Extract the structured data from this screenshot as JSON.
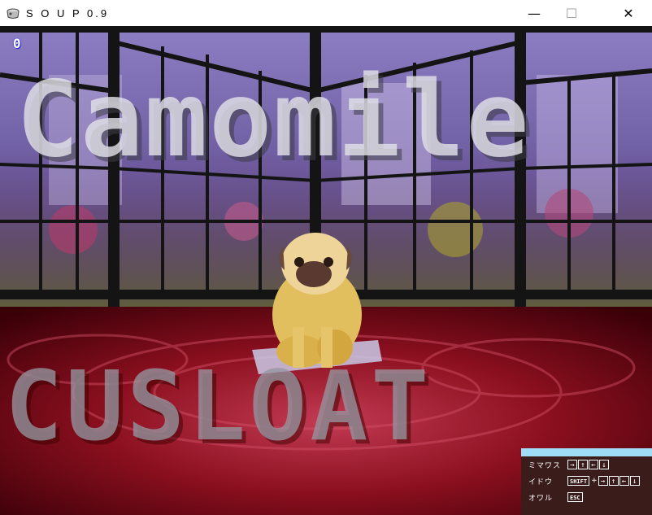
{
  "window": {
    "title": "S O U P 0.9",
    "app_icon": "soup-pot-icon",
    "minimize_icon": "minimize-icon",
    "maximize_icon": "maximize-icon",
    "close_icon": "close-icon"
  },
  "hud": {
    "score": "0"
  },
  "overlay": {
    "title_text": "Camomile",
    "subtitle_text": "CUSLOAT"
  },
  "help": {
    "rows": [
      {
        "label": "ミマワス",
        "keys": [
          "→",
          "↑",
          "←",
          "↓"
        ]
      },
      {
        "label": "イドウ",
        "modifier": "SHIFT",
        "plus": "+",
        "keys": [
          "→",
          "↑",
          "←",
          "↓"
        ]
      },
      {
        "label": "オワル",
        "keys": [
          "ESC"
        ]
      }
    ]
  },
  "colors": {
    "help_bar": "#9fdcf5",
    "help_bg": "#3a1c1a",
    "floor": "#8a0f1e",
    "window_frame": "#141414"
  }
}
